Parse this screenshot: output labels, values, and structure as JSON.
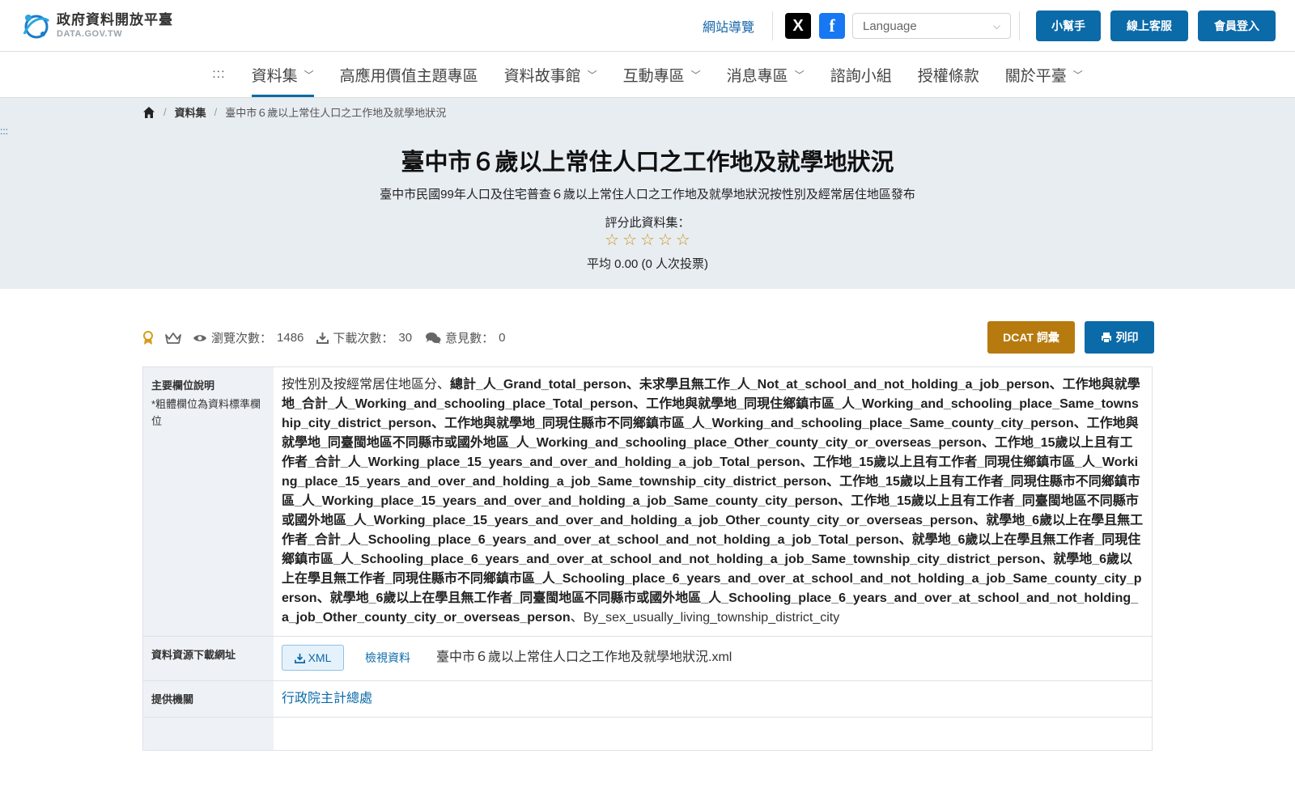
{
  "header": {
    "logo_cn": "政府資料開放平臺",
    "logo_en": "DATA.GOV.TW",
    "sitemap": "網站導覽",
    "social_x": "X",
    "social_fb": "f",
    "language_placeholder": "Language",
    "btn_helper": "小幫手",
    "btn_service": "線上客服",
    "btn_login": "會員登入"
  },
  "nav": {
    "accesskey": ":::",
    "items": [
      {
        "label": "資料集"
      },
      {
        "label": "高應用價值主題專區"
      },
      {
        "label": "資料故事館"
      },
      {
        "label": "互動專區"
      },
      {
        "label": "消息專區"
      },
      {
        "label": "諮詢小組"
      },
      {
        "label": "授權條款"
      },
      {
        "label": "關於平臺"
      }
    ]
  },
  "breadcrumb": {
    "level1": "資料集",
    "current": "臺中市６歲以上常住人口之工作地及就學地狀況"
  },
  "hero": {
    "accesskey": ":::",
    "title": "臺中市６歲以上常住人口之工作地及就學地狀況",
    "subtitle": "臺中市民國99年人口及住宅普查６歲以上常住人口之工作地及就學地狀況按性別及經常居住地區發布",
    "rating_label": "評分此資料集：",
    "rating_value": 0,
    "rating_max": 5,
    "average": "平均 0.00 (0 人次投票)"
  },
  "stats": {
    "views_label": "瀏覽次數：",
    "views": "1486",
    "downloads_label": "下載次數：",
    "downloads": "30",
    "comments_label": "意見數：",
    "comments": "0",
    "btn_dcat": "DCAT 詞彙",
    "btn_print": "列印"
  },
  "table": {
    "fields": {
      "label": "主要欄位說明",
      "note": "*粗體欄位為資料標準欄位",
      "prefix": "按性別及按經常居住地區分、",
      "bold": "總計_人_Grand_total_person、未求學且無工作_人_Not_at_school_and_not_holding_a_job_person、工作地與就學地_合計_人_Working_and_schooling_place_Total_person、工作地與就學地_同現住鄉鎮市區_人_Working_and_schooling_place_Same_township_city_district_person、工作地與就學地_同現住縣市不同鄉鎮市區_人_Working_and_schooling_place_Same_county_city_person、工作地與就學地_同臺閩地區不同縣市或國外地區_人_Working_and_schooling_place_Other_county_city_or_overseas_person、工作地_15歲以上且有工作者_合計_人_Working_place_15_years_and_over_and_holding_a_job_Total_person、工作地_15歲以上且有工作者_同現住鄉鎮市區_人_Working_place_15_years_and_over_and_holding_a_job_Same_township_city_district_person、工作地_15歲以上且有工作者_同現住縣市不同鄉鎮市區_人_Working_place_15_years_and_over_and_holding_a_job_Same_county_city_person、工作地_15歲以上且有工作者_同臺閩地區不同縣市或國外地區_人_Working_place_15_years_and_over_and_holding_a_job_Other_county_city_or_overseas_person、就學地_6歲以上在學且無工作者_合計_人_Schooling_place_6_years_and_over_at_school_and_not_holding_a_job_Total_person、就學地_6歲以上在學且無工作者_同現住鄉鎮市區_人_Schooling_place_6_years_and_over_at_school_and_not_holding_a_job_Same_township_city_district_person、就學地_6歲以上在學且無工作者_同現住縣市不同鄉鎮市區_人_Schooling_place_6_years_and_over_at_school_and_not_holding_a_job_Same_county_city_person、就學地_6歲以上在學且無工作者_同臺閩地區不同縣市或國外地區_人_Schooling_place_6_years_and_over_at_school_and_not_holding_a_job_Other_county_city_or_overseas_person",
      "suffix": "、By_sex_usually_living_township_district_city"
    },
    "resource": {
      "label": "資料資源下載網址",
      "btn_xml": "XML",
      "view": "檢視資料",
      "filename": "臺中市６歲以上常住人口之工作地及就學地狀況.xml"
    },
    "provider": {
      "label": "提供機關",
      "value": "行政院主計總處"
    }
  },
  "colors": {
    "primary": "#0b6aa8",
    "dcat": "#b77a0e",
    "hero_bg": "#e8edf2",
    "star": "#c8961a"
  }
}
